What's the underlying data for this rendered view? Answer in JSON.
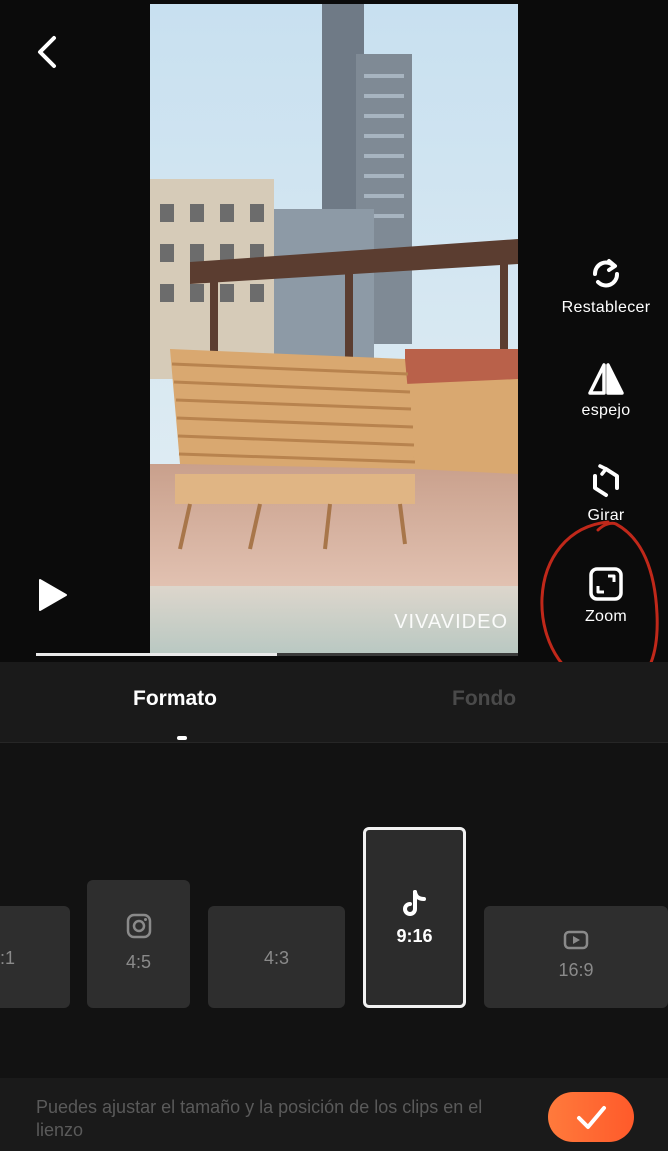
{
  "preview": {
    "watermark": "VIVAVIDEO",
    "progress": 0.5
  },
  "tools": [
    {
      "icon": "reset-icon",
      "label": "Restablecer"
    },
    {
      "icon": "mirror-icon",
      "label": "espejo"
    },
    {
      "icon": "rotate-icon",
      "label": "Girar"
    },
    {
      "icon": "zoom-icon",
      "label": "Zoom"
    }
  ],
  "tabs": {
    "formato": "Formato",
    "fondo": "Fondo",
    "active": "Formato"
  },
  "ratios": [
    {
      "label": ":1",
      "icon": ""
    },
    {
      "label": "4:5",
      "icon": "instagram-icon"
    },
    {
      "label": "4:3",
      "icon": ""
    },
    {
      "label": "9:16",
      "icon": "tiktok-icon",
      "selected": true
    },
    {
      "label": "16:9",
      "icon": "youtube-icon"
    }
  ],
  "footer": {
    "hint": "Puedes ajustar el tamaño y la posición de los clips en el lienzo",
    "confirm_icon": "checkmark-icon"
  },
  "colors": {
    "accent": "#ff6a32",
    "annotation": "#c0281a",
    "background": "#121212"
  }
}
